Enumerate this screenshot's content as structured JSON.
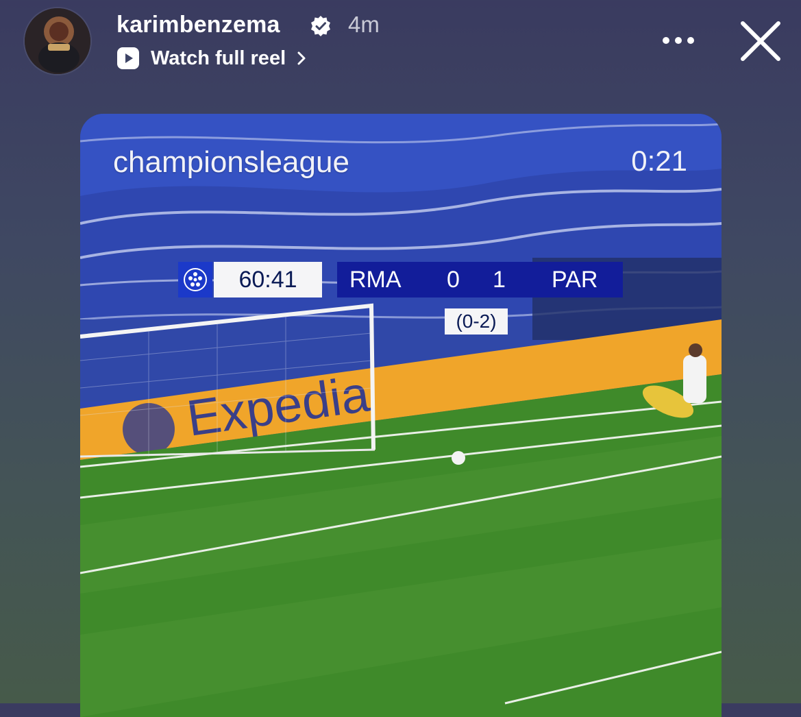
{
  "header": {
    "username": "karimbenzema",
    "time_ago": "4m",
    "reel_link_label": "Watch full reel"
  },
  "video": {
    "channel": "championsleague",
    "elapsed": "0:21",
    "scoreboard": {
      "clock": "60:41",
      "home_team": "RMA",
      "home_score": "0",
      "away_score": "1",
      "away_team": "PAR",
      "aggregate": "(0-2)"
    },
    "banner_ad": "Expedia"
  },
  "colors": {
    "scoreboard_blue": "#121d9a",
    "pitch_green": "#3f8a2a",
    "ad_board_orange": "#f0a52a"
  }
}
